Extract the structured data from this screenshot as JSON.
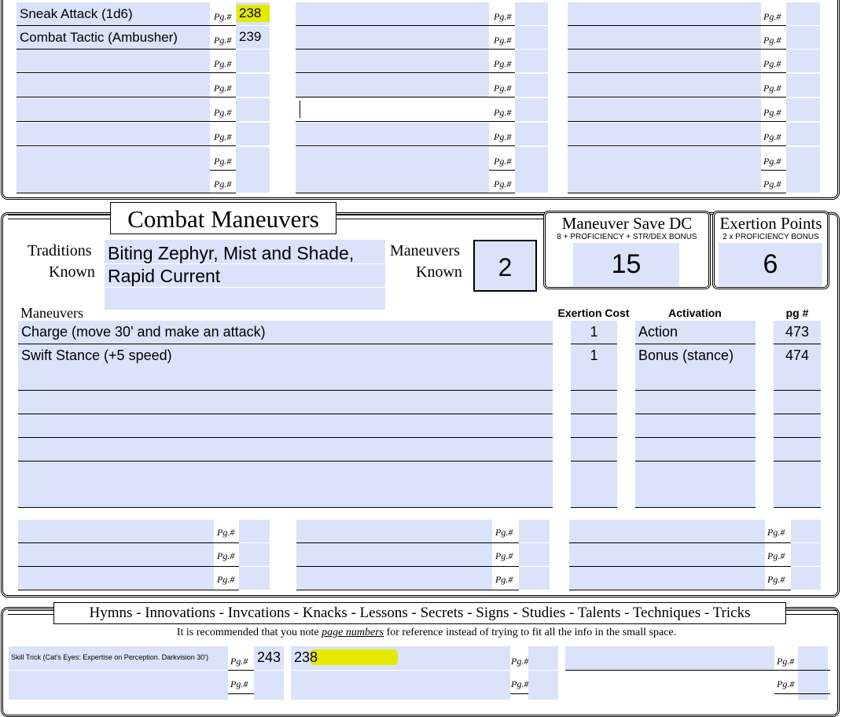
{
  "pg_label": "Pg.#",
  "top_section": {
    "col1": [
      {
        "name": "Sneak Attack (1d6)",
        "pg": "238",
        "highlight": true
      },
      {
        "name": "Combat Tactic (Ambusher)",
        "pg": "239",
        "highlight": false
      },
      {
        "name": "",
        "pg": ""
      },
      {
        "name": "",
        "pg": ""
      },
      {
        "name": "",
        "pg": ""
      },
      {
        "name": "",
        "pg": ""
      },
      {
        "name": "",
        "pg": ""
      },
      {
        "name": "",
        "pg": ""
      }
    ]
  },
  "combat_maneuvers": {
    "title": "Combat Maneuvers",
    "traditions_label_1": "Traditions",
    "traditions_label_2": "Known",
    "traditions_line1": "Biting Zephyr, Mist and Shade,",
    "traditions_line2": "Rapid Current",
    "maneuvers_known_label_1": "Maneuvers",
    "maneuvers_known_label_2": "Known",
    "maneuvers_known": "2",
    "save_dc_title": "Maneuver Save DC",
    "save_dc_sub": "8 + PROFICIENCY + STR/DEX BONUS",
    "save_dc_value": "15",
    "exertion_title": "Exertion Points",
    "exertion_sub": "2 x PROFICIENCY BONUS",
    "exertion_value": "6",
    "col_maneuvers": "Maneuvers",
    "col_cost": "Exertion Cost",
    "col_activation": "Activation",
    "col_pg": "pg #",
    "rows": [
      {
        "name": "Charge (move 30' and make an attack)",
        "cost": "1",
        "activation": "Action",
        "pg": "473"
      },
      {
        "name": "Swift Stance (+5 speed)",
        "cost": "1",
        "activation": "Bonus (stance)",
        "pg": "474"
      },
      {
        "name": "",
        "cost": "",
        "activation": "",
        "pg": ""
      },
      {
        "name": "",
        "cost": "",
        "activation": "",
        "pg": ""
      },
      {
        "name": "",
        "cost": "",
        "activation": "",
        "pg": ""
      },
      {
        "name": "",
        "cost": "",
        "activation": "",
        "pg": ""
      },
      {
        "name": "",
        "cost": "",
        "activation": "",
        "pg": ""
      },
      {
        "name": "",
        "cost": "",
        "activation": "",
        "pg": ""
      }
    ]
  },
  "hymns": {
    "title": "Hymns - Innovations - Invcations - Knacks - Lessons - Secrets - Signs - Studies - Talents - Techniques - Tricks",
    "note_before": "It is recommended that you note ",
    "note_em": "page numbers",
    "note_after": " for reference instead of trying to fit all the info in the small space.",
    "row1_col1_name": "Skill Trick (Cat's Eyes: Expertise on Perception. Darkvision 30')",
    "row1_col1_pg": "243",
    "row1_col2_name": "238"
  },
  "colors": {
    "field": "#dbe3fb",
    "highlight": "#e5ea00"
  }
}
